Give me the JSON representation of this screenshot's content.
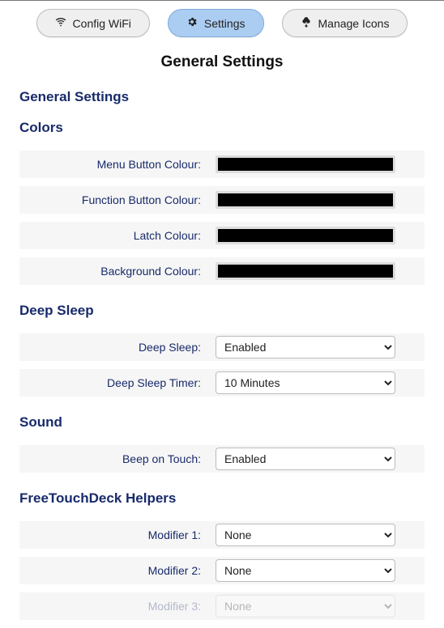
{
  "tabs": {
    "wifi": "Config WiFi",
    "settings": "Settings",
    "icons": "Manage Icons"
  },
  "page_title": "General Settings",
  "sections": {
    "general": "General Settings",
    "colors": "Colors",
    "deepsleep": "Deep Sleep",
    "sound": "Sound",
    "helpers": "FreeTouchDeck Helpers"
  },
  "fields": {
    "menu_button_colour": {
      "label": "Menu Button Colour:",
      "value": "#000000"
    },
    "function_button_colour": {
      "label": "Function Button Colour:",
      "value": "#000000"
    },
    "latch_colour": {
      "label": "Latch Colour:",
      "value": "#000000"
    },
    "background_colour": {
      "label": "Background Colour:",
      "value": "#000000"
    },
    "deep_sleep": {
      "label": "Deep Sleep:",
      "value": "Enabled"
    },
    "deep_sleep_timer": {
      "label": "Deep Sleep Timer:",
      "value": "10 Minutes"
    },
    "beep_on_touch": {
      "label": "Beep on Touch:",
      "value": "Enabled"
    },
    "modifier1": {
      "label": "Modifier 1:",
      "value": "None"
    },
    "modifier2": {
      "label": "Modifier 2:",
      "value": "None"
    },
    "modifier3": {
      "label": "Modifier 3:",
      "value": "None"
    }
  }
}
